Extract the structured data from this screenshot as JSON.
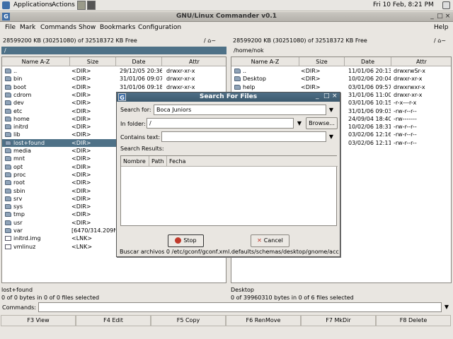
{
  "panel": {
    "applications": "Applications",
    "actions": "Actions",
    "clock": "Fri 10 Feb,  8:21 PM"
  },
  "window": {
    "title": "GNU/Linux Commander v0.1"
  },
  "menubar": {
    "items": [
      "File",
      "Mark",
      "Commands",
      "Show",
      "Bookmarks",
      "Configuration"
    ],
    "help": "Help"
  },
  "left": {
    "free": "28599200 KB (30251080) of 32518372 KB Free",
    "nav": "/ ⌂~",
    "path": "/",
    "columns": [
      "Name A-Z",
      "Size",
      "Date",
      "Attr"
    ],
    "rows": [
      {
        "name": "..",
        "size": "<DIR>",
        "date": "29/12/05 20:36",
        "attr": "drwxr-xr-x",
        "icon": "folder"
      },
      {
        "name": "bin",
        "size": "<DIR>",
        "date": "31/01/06 09:07",
        "attr": "drwxr-xr-x",
        "icon": "folder"
      },
      {
        "name": "boot",
        "size": "<DIR>",
        "date": "31/01/06 09:18",
        "attr": "drwxr-xr-x",
        "icon": "folder"
      },
      {
        "name": "cdrom",
        "size": "<DIR>",
        "date": "",
        "attr": "",
        "icon": "folder"
      },
      {
        "name": "dev",
        "size": "<DIR>",
        "date": "",
        "attr": "",
        "icon": "folder"
      },
      {
        "name": "etc",
        "size": "<DIR>",
        "date": "",
        "attr": "",
        "icon": "folder"
      },
      {
        "name": "home",
        "size": "<DIR>",
        "date": "",
        "attr": "",
        "icon": "folder"
      },
      {
        "name": "initrd",
        "size": "<DIR>",
        "date": "",
        "attr": "",
        "icon": "folder"
      },
      {
        "name": "lib",
        "size": "<DIR>",
        "date": "",
        "attr": "",
        "icon": "folder"
      },
      {
        "name": "lost+found",
        "size": "<DIR>",
        "date": "",
        "attr": "",
        "icon": "folder",
        "selected": true
      },
      {
        "name": "media",
        "size": "<DIR>",
        "date": "",
        "attr": "",
        "icon": "folder"
      },
      {
        "name": "mnt",
        "size": "<DIR>",
        "date": "",
        "attr": "",
        "icon": "folder"
      },
      {
        "name": "opt",
        "size": "<DIR>",
        "date": "",
        "attr": "",
        "icon": "folder"
      },
      {
        "name": "proc",
        "size": "<DIR>",
        "date": "",
        "attr": "",
        "icon": "folder"
      },
      {
        "name": "root",
        "size": "<DIR>",
        "date": "",
        "attr": "",
        "icon": "folder"
      },
      {
        "name": "sbin",
        "size": "<DIR>",
        "date": "",
        "attr": "",
        "icon": "folder"
      },
      {
        "name": "srv",
        "size": "<DIR>",
        "date": "",
        "attr": "",
        "icon": "folder"
      },
      {
        "name": "sys",
        "size": "<DIR>",
        "date": "",
        "attr": "",
        "icon": "folder"
      },
      {
        "name": "tmp",
        "size": "<DIR>",
        "date": "",
        "attr": "",
        "icon": "folder"
      },
      {
        "name": "usr",
        "size": "<DIR>",
        "date": "",
        "attr": "",
        "icon": "folder"
      },
      {
        "name": "var",
        "size": "[6470/314.209M",
        "date": "",
        "attr": "",
        "icon": "folder"
      },
      {
        "name": "initrd.img",
        "size": "<LNK>",
        "date": "",
        "attr": "",
        "icon": "file"
      },
      {
        "name": "vmlinuz",
        "size": "<LNK>",
        "date": "",
        "attr": "",
        "icon": "file"
      }
    ],
    "status_name": "lost+found",
    "status_bytes": "0 of 0 bytes in 0 of 0 files selected"
  },
  "right": {
    "free": "28599200 KB (30251080) of 32518372 KB Free",
    "nav": "/ ⌂~",
    "path": "/home/nok",
    "columns": [
      "Name A-Z",
      "Size",
      "Date",
      "Attr"
    ],
    "rows": [
      {
        "name": "..",
        "size": "<DIR>",
        "date": "11/01/06 20:13",
        "attr": "drwxrwSr-x",
        "icon": "folder"
      },
      {
        "name": "Desktop",
        "size": "<DIR>",
        "date": "10/02/06 20:04",
        "attr": "drwxr-xr-x",
        "icon": "folder"
      },
      {
        "name": "help",
        "size": "<DIR>",
        "date": "03/01/06 09:57",
        "attr": "drwxrwxr-x",
        "icon": "folder"
      },
      {
        "name": "",
        "size": "",
        "date": "31/01/06 11:00",
        "attr": "drwxr-xr-x",
        "icon": "none"
      },
      {
        "name": "",
        "size": "",
        "date": "03/01/06 10:15",
        "attr": "-r-x---r-x",
        "icon": "none"
      },
      {
        "name": "",
        "size": "",
        "date": "31/01/06 09:03",
        "attr": "-rw-r--r--",
        "icon": "none"
      },
      {
        "name": "",
        "size": "",
        "date": "24/09/04 18:40",
        "attr": "-rw-------",
        "icon": "none"
      },
      {
        "name": "",
        "size": "",
        "date": "10/02/06 18:31",
        "attr": "-rw-r--r--",
        "icon": "none"
      },
      {
        "name": "",
        "size": "",
        "date": "03/02/06 12:16",
        "attr": "-rw-r--r--",
        "icon": "none"
      },
      {
        "name": "",
        "size": "",
        "date": "03/02/06 12:11",
        "attr": "-rw-r--r--",
        "icon": "none"
      }
    ],
    "status_name": "Desktop",
    "status_bytes": "0 of 39960310 bytes in 0 of 6 files selected"
  },
  "commands": {
    "label": "Commands:"
  },
  "fkeys": [
    "F3 View",
    "F4 Edit",
    "F5 Copy",
    "F6 RenMove",
    "F7 MkDir",
    "F8 Delete"
  ],
  "dialog": {
    "title": "Search For Files",
    "search_for_label": "Search for:",
    "search_for_value": "Boca Juniors",
    "in_folder_label": "In folder:",
    "in_folder_value": "/",
    "browse": "Browse...",
    "contains_label": "Contains text:",
    "contains_value": "",
    "results_label": "Search Results:",
    "result_columns": [
      "Nombre",
      "Path",
      "Fecha"
    ],
    "stop": "Stop",
    "cancel": "Cancel",
    "status": "Buscar archivos  0  /etc/gconf/gconf.xml.defaults/schemas/desktop/gnome/acc"
  }
}
